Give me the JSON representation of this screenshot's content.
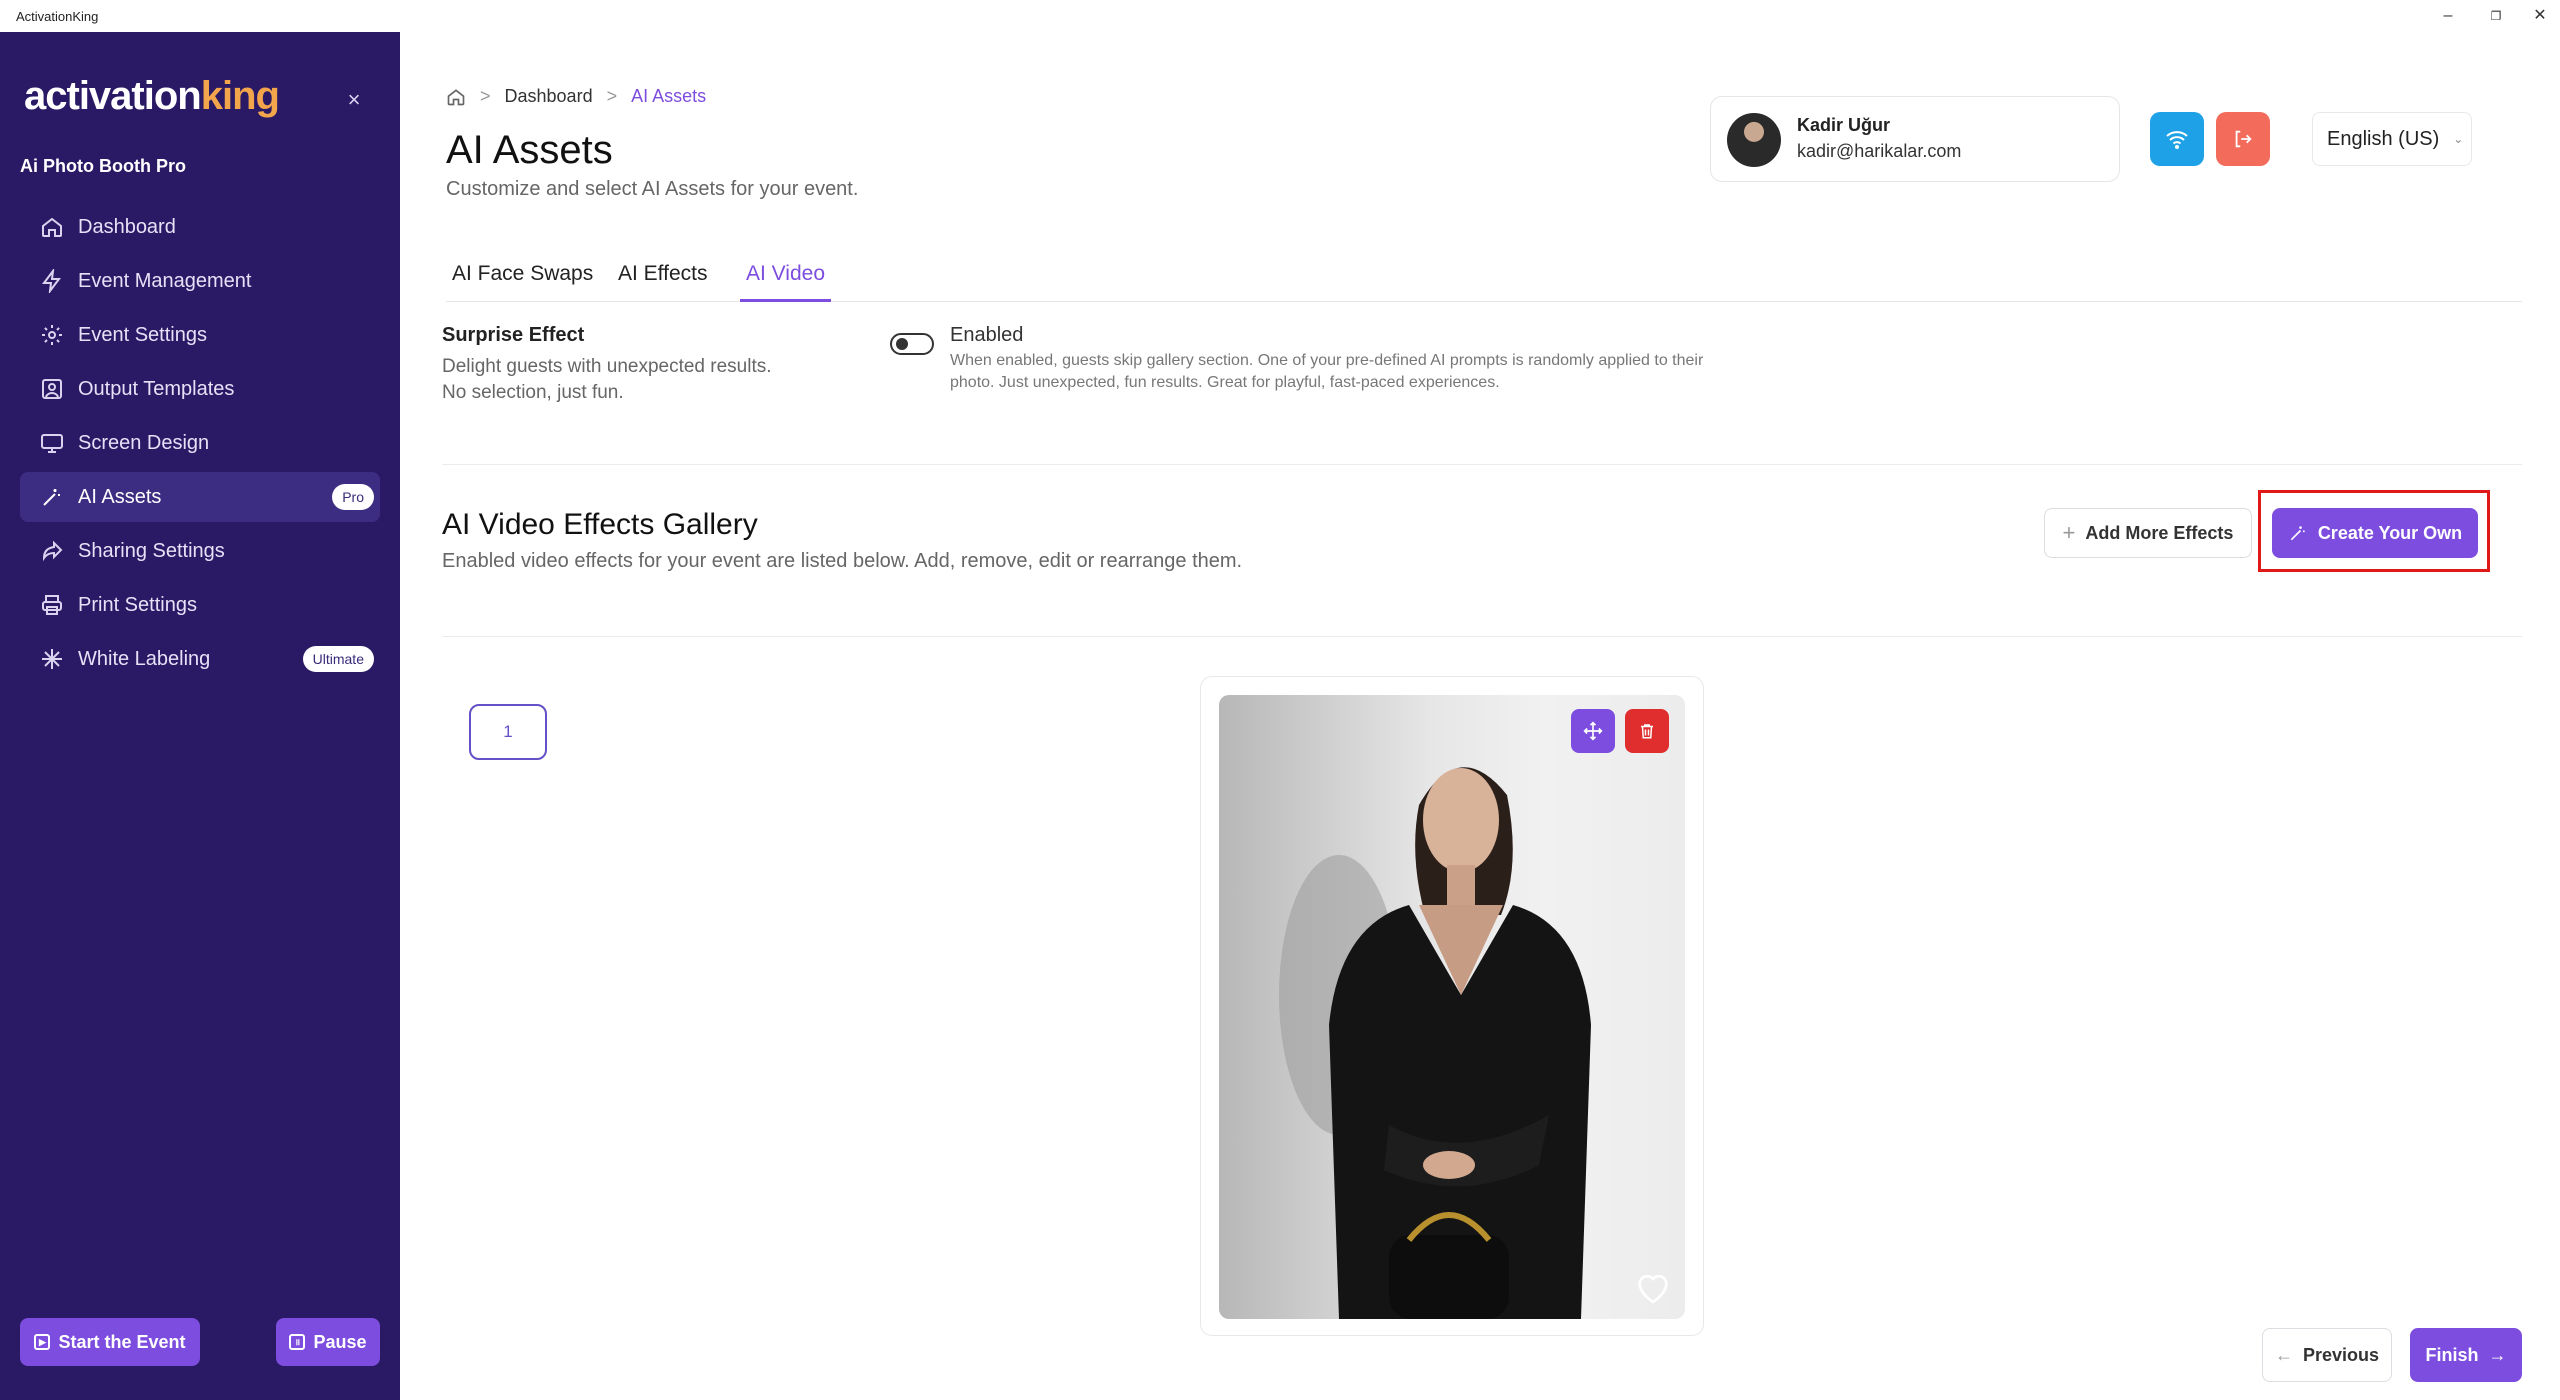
{
  "window": {
    "title": "ActivationKing"
  },
  "sidebar": {
    "logo_main": "activation",
    "logo_accent": "king",
    "product": "Ai Photo Booth Pro",
    "items": [
      {
        "label": "Dashboard",
        "icon": "home-icon"
      },
      {
        "label": "Event Management",
        "icon": "bolt-icon"
      },
      {
        "label": "Event Settings",
        "icon": "gear-icon"
      },
      {
        "label": "Output Templates",
        "icon": "portrait-icon"
      },
      {
        "label": "Screen Design",
        "icon": "monitor-icon"
      },
      {
        "label": "AI Assets",
        "icon": "magic-wand-icon",
        "badge": "Pro",
        "active": true
      },
      {
        "label": "Sharing Settings",
        "icon": "share-icon"
      },
      {
        "label": "Print Settings",
        "icon": "printer-icon"
      },
      {
        "label": "White Labeling",
        "icon": "sparkle-icon",
        "badge": "Ultimate"
      }
    ],
    "start_label": "Start the Event",
    "pause_label": "Pause"
  },
  "breadcrumb": {
    "sep": ">",
    "parent": "Dashboard",
    "current": "AI Assets"
  },
  "header": {
    "title": "AI Assets",
    "subtitle": "Customize and select AI Assets for your event."
  },
  "user": {
    "name": "Kadir Uğur",
    "email": "kadir@harikalar.com"
  },
  "language": {
    "selected": "English (US)"
  },
  "tabs": [
    {
      "label": "AI Face Swaps"
    },
    {
      "label": "AI Effects"
    },
    {
      "label": "AI Video",
      "active": true
    }
  ],
  "surprise": {
    "title": "Surprise Effect",
    "desc_line1": "Delight guests with unexpected results.",
    "desc_line2": "No selection, just fun.",
    "toggle_label": "Enabled",
    "toggle_on": false,
    "toggle_desc": "When enabled, guests skip gallery section. One of your pre-defined AI prompts is randomly applied to their photo. Just unexpected, fun results. Great for playful, fast-paced experiences."
  },
  "gallery": {
    "title": "AI Video Effects Gallery",
    "subtitle": "Enabled video effects for your event are listed below. Add, remove, edit or rearrange them.",
    "add_label": "Add More Effects",
    "create_label": "Create Your Own",
    "items": [
      {
        "index": "1"
      }
    ]
  },
  "footer": {
    "prev_label": "Previous",
    "finish_label": "Finish"
  },
  "colors": {
    "sidebar": "#2a1a66",
    "accent": "#7c4ddf",
    "danger": "#e02d2d",
    "wifi": "#1ea1e6",
    "logout": "#f26b5b"
  }
}
